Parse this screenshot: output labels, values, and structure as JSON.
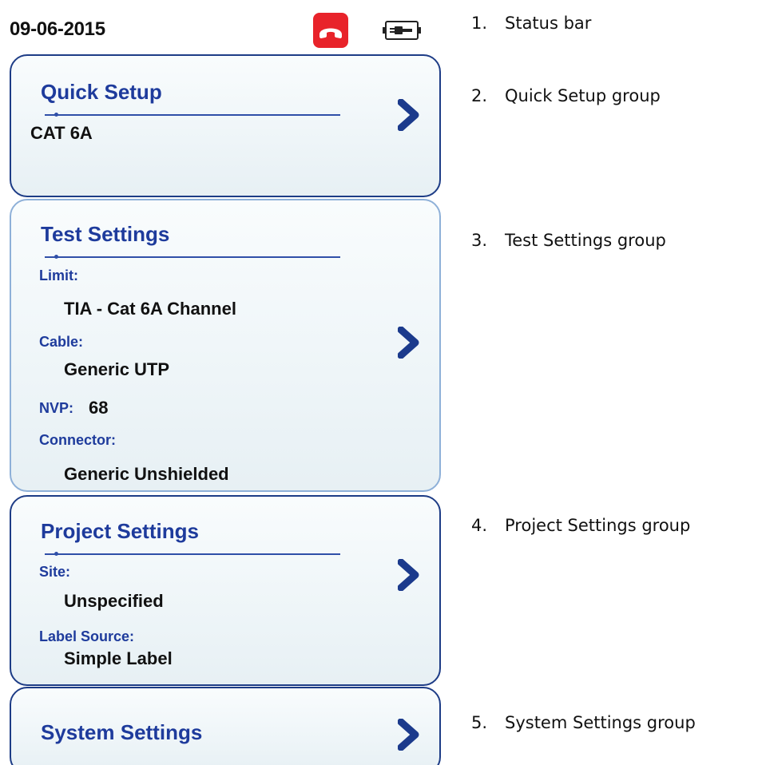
{
  "status_bar": {
    "date": "09-06-2015",
    "icons": [
      "hangup-phone-icon",
      "ac-power-battery-icon"
    ],
    "colors": {
      "hangup_bg": "#e8232a"
    }
  },
  "groups": {
    "quick_setup": {
      "title": "Quick Setup",
      "value": "CAT 6A"
    },
    "test_settings": {
      "title": "Test Settings",
      "limit_label": "Limit:",
      "limit_value": "TIA - Cat 6A Channel",
      "cable_label": "Cable:",
      "cable_value": "Generic UTP",
      "nvp_label": "NVP:",
      "nvp_value": "68",
      "connector_label": "Connector:",
      "connector_value": "Generic Unshielded"
    },
    "project_settings": {
      "title": "Project Settings",
      "site_label": "Site:",
      "site_value": "Unspecified",
      "label_source_label": "Label Source:",
      "label_source_value": "Simple Label"
    },
    "system_settings": {
      "title": "System Settings"
    }
  },
  "legend": [
    {
      "num": "1.",
      "text": "Status bar"
    },
    {
      "num": "2.",
      "text": "Quick Setup group"
    },
    {
      "num": "3.",
      "text": "Test Settings group"
    },
    {
      "num": "4.",
      "text": "Project Settings group"
    },
    {
      "num": "5.",
      "text": "System Settings group"
    }
  ],
  "colors": {
    "title_blue": "#1e3b9c",
    "border_dark": "#1d3c86",
    "border_selected": "#8eb0d8",
    "chevron": "#1b3a8c"
  }
}
